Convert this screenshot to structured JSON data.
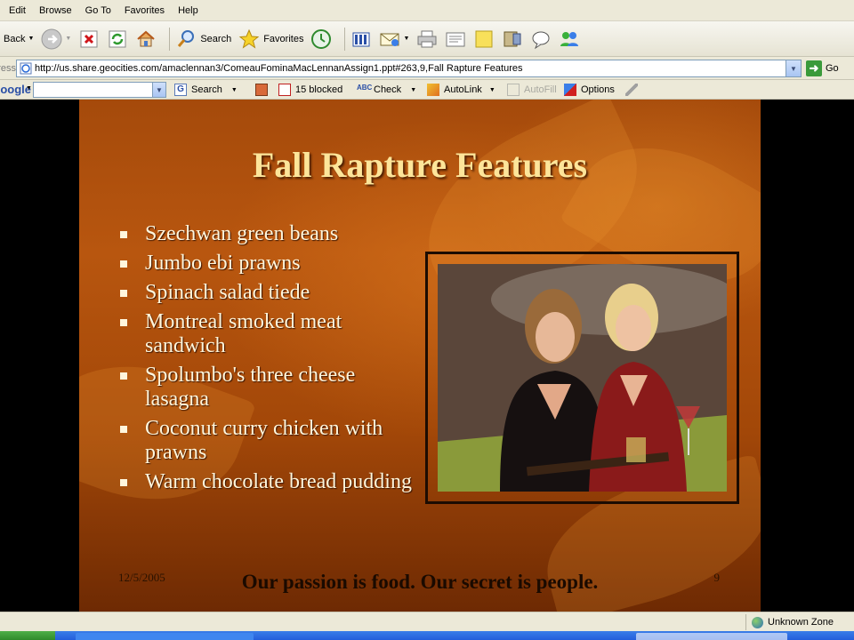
{
  "menu": [
    "Edit",
    "Browse",
    "Go To",
    "Favorites",
    "Help"
  ],
  "toolbar": {
    "back_label": "Back",
    "search_label": "Search",
    "favorites_label": "Favorites"
  },
  "address": {
    "label": "Address",
    "url": "http://us.share.geocities.com/amaclennan3/ComeauFominaMacLennanAssign1.ppt#263,9,Fall Rapture Features",
    "go_label": "Go"
  },
  "google_bar": {
    "logo": "Google",
    "search_value": "",
    "search_label": "Search",
    "blocked_label": "15 blocked",
    "check_label": "Check",
    "autolink_label": "AutoLink",
    "autofill_label": "AutoFill",
    "options_label": "Options"
  },
  "slide": {
    "title": "Fall Rapture Features",
    "bullets": [
      "Szechwan green beans",
      "Jumbo ebi prawns",
      "Spinach salad tiede",
      "Montreal smoked meat sandwich",
      "Spolumbo's three cheese lasagna",
      "Coconut curry chicken with prawns",
      "Warm chocolate bread pudding"
    ],
    "date": "12/5/2005",
    "slogan": "Our passion is food. Our secret is people.",
    "page_number": "9"
  },
  "status": {
    "zone": "Unknown Zone"
  },
  "colors": {
    "title": "#fde59a",
    "bullet_text": "#fff6dc",
    "slide_bg": "#a54a0b",
    "chrome": "#ece9d8"
  }
}
